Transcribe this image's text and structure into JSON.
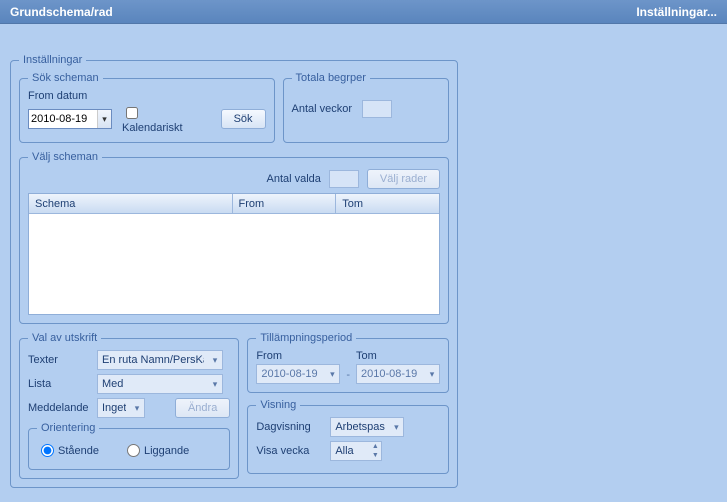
{
  "titlebar": {
    "left": "Grundschema/rad",
    "right": "Inställningar..."
  },
  "main_legend": "Inställningar",
  "sok": {
    "legend": "Sök scheman",
    "from_label": "From datum",
    "from_value": "2010-08-19",
    "kalendariskt": "Kalendariskt",
    "sok_btn": "Sök"
  },
  "totala": {
    "legend": "Totala  begrper",
    "antal_veckor": "Antal veckor"
  },
  "valj": {
    "legend": "Välj scheman",
    "antal_valda": "Antal valda",
    "valj_rader_btn": "Välj rader",
    "headers": {
      "schema": "Schema",
      "from": "From",
      "tom": "Tom"
    }
  },
  "utskrift": {
    "legend": "Val av utskrift",
    "texter_lbl": "Texter",
    "texter_val": "En ruta Namn/PersKat",
    "lista_lbl": "Lista",
    "lista_val": "Med",
    "medd_lbl": "Meddelande",
    "medd_val": "Inget",
    "andra_btn": "Ändra"
  },
  "orient": {
    "legend": "Orientering",
    "staende": "Stående",
    "liggande": "Liggande"
  },
  "tillamp": {
    "legend": "Tillämpningsperiod",
    "from_lbl": "From",
    "from_val": "2010-08-19",
    "tom_lbl": "Tom",
    "tom_val": "2010-08-19",
    "dash": "-"
  },
  "visning": {
    "legend": "Visning",
    "dag_lbl": "Dagvisning",
    "dag_val": "Arbetspas",
    "vecka_lbl": "Visa vecka",
    "vecka_val": "Alla"
  }
}
